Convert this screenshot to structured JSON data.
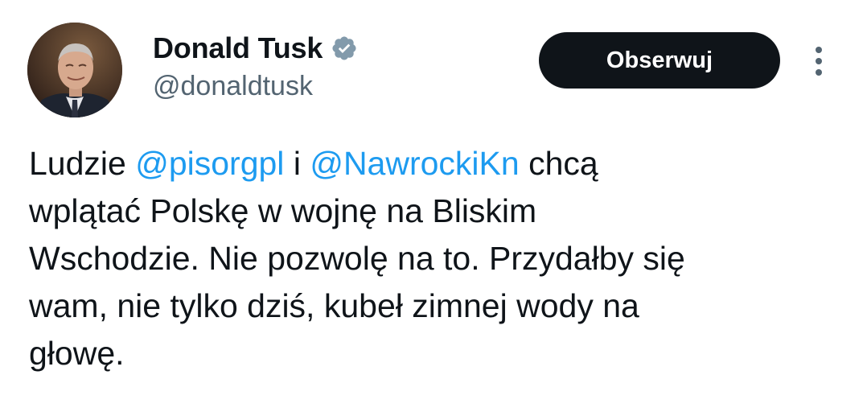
{
  "author": {
    "display_name": "Donald Tusk",
    "handle": "@donaldtusk",
    "verified_icon": "verified-badge-icon",
    "verified_color": "#829aab"
  },
  "actions": {
    "follow_label": "Obserwuj",
    "more_icon": "more-vertical-icon"
  },
  "tweet": {
    "line1": {
      "t1": "Ludzie ",
      "m1": "@pisorgpl",
      "t2": " i ",
      "m2": "@NawrockiKn",
      "t3": " chcą"
    },
    "line2": "wplątać Polskę w wojnę na Bliskim",
    "line3": "Wschodzie. Nie pozwolę na to. Przydałby się",
    "line4": "wam, nie tylko dziś, kubeł zimnej wody na",
    "line5": "głowę."
  },
  "colors": {
    "text": "#0f1419",
    "secondary": "#536471",
    "link": "#1d9bf0",
    "button_bg": "#0f1419",
    "button_text": "#ffffff"
  }
}
